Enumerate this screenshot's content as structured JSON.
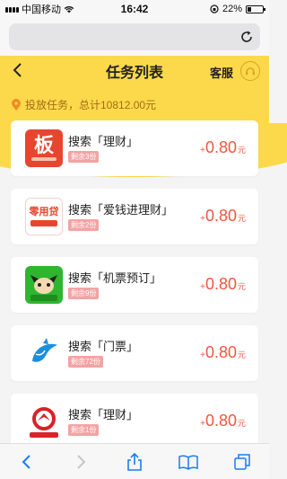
{
  "status_bar": {
    "carrier": "中国移动",
    "time": "16:42",
    "battery": "22%",
    "battery_level": 0.22
  },
  "header": {
    "title": "任务列表",
    "service_label": "客服"
  },
  "summary": {
    "text": "投放任务，总计10812.00元"
  },
  "tasks": [
    {
      "name": "搜索「理财」",
      "remaining": "剩余3份",
      "plus": "+",
      "price": "0.80",
      "unit": "元",
      "icon": "ban-app-icon"
    },
    {
      "name": "搜索「爱钱进理财」",
      "remaining": "剩余2份",
      "plus": "+",
      "price": "0.80",
      "unit": "元",
      "icon": "lingyongdai-app-icon"
    },
    {
      "name": "搜索「机票预订」",
      "remaining": "剩余9份",
      "plus": "+",
      "price": "0.80",
      "unit": "元",
      "icon": "cow-app-icon"
    },
    {
      "name": "搜索「门票」",
      "remaining": "剩余72份",
      "plus": "+",
      "price": "0.80",
      "unit": "元",
      "icon": "dolphin-app-icon"
    },
    {
      "name": "搜索「理财」",
      "remaining": "剩余1份",
      "plus": "+",
      "price": "0.80",
      "unit": "元",
      "icon": "bank-app-icon"
    }
  ],
  "icons": {
    "ban_label": "板",
    "lingyongdai_label": "零用贷"
  },
  "colors": {
    "accent_yellow": "#fcd94a",
    "price_red": "#f0573d"
  }
}
